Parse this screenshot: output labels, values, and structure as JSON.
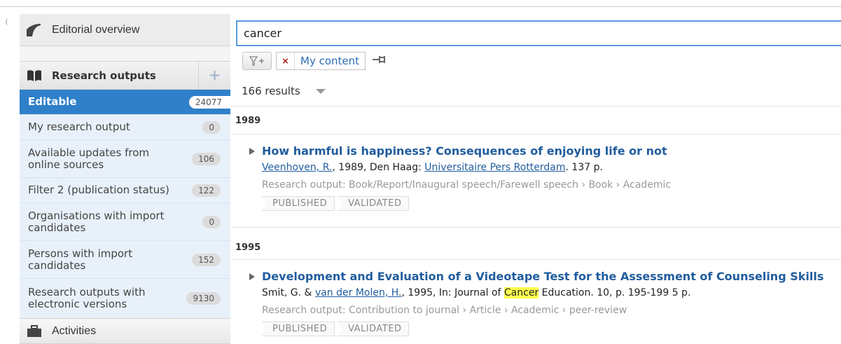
{
  "sidebar": {
    "editorial": "Editorial overview",
    "research": "Research outputs",
    "activities": "Activities",
    "plus": "+",
    "items": [
      {
        "label": "Editable",
        "count": "24077"
      },
      {
        "label": "My research output",
        "count": "0"
      },
      {
        "label": "Available updates from online sources",
        "count": "106"
      },
      {
        "label": "Filter 2 (publication status)",
        "count": "122"
      },
      {
        "label": "Organisations with import candidates",
        "count": "0"
      },
      {
        "label": "Persons with import candidates",
        "count": "152"
      },
      {
        "label": "Research outputs with electronic versions",
        "count": "9130"
      }
    ]
  },
  "search": {
    "value": "cancer"
  },
  "filters": {
    "chip_label": "My content",
    "chip_remove": "×"
  },
  "results": {
    "count_label": "166 results",
    "groups": [
      {
        "year": "1989",
        "title": "How harmful is happiness? Consequences of enjoying life or not",
        "author": "Veenhoven, R.",
        "cite_mid": ", 1989, Den Haag: ",
        "publisher": "Universitaire Pers Rotterdam",
        "cite_end": ". 137 p.",
        "type": "Research output: Book/Report/Inaugural speech/Farewell speech › Book › Academic",
        "tags": [
          "PUBLISHED",
          "VALIDATED"
        ]
      },
      {
        "year": "1995",
        "title": "Development and Evaluation of a Videotape Test for the Assessment of Counseling Skills",
        "author1": "Smit, G.",
        "amp": " & ",
        "author2": "van der Molen, H.",
        "cite_mid": ", 1995, In: Journal of ",
        "highlight": "Cancer",
        "cite_end": " Education. 10, p. 195-199 5 p.",
        "type": "Research output: Contribution to journal › Article › Academic › peer-review",
        "tags": [
          "PUBLISHED",
          "VALIDATED"
        ]
      }
    ]
  },
  "colors": {
    "accent": "#2f80c9",
    "link": "#215d9e",
    "highlight": "#ffff4d"
  }
}
